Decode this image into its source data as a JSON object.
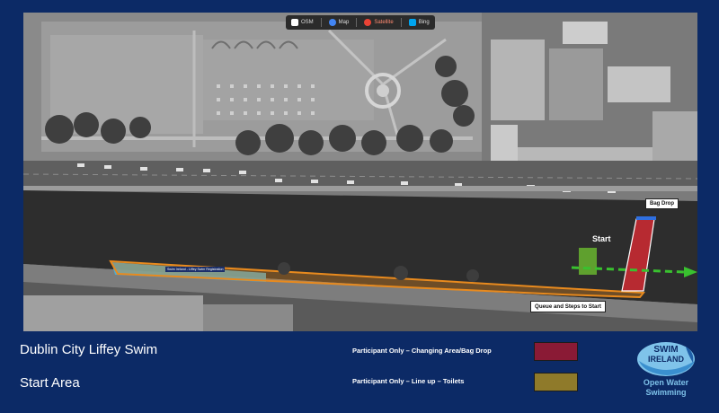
{
  "map_toolbar": {
    "items": [
      {
        "label": "OSM",
        "icon": "osm-icon",
        "color": "#ffffff"
      },
      {
        "label": "Map",
        "icon": "google-icon",
        "color": "#4285f4"
      },
      {
        "label": "Satellite",
        "icon": "google-icon",
        "color": "#ea4335"
      },
      {
        "label": "Bing",
        "icon": "bing-icon",
        "color": "#00a4ef"
      }
    ]
  },
  "map_labels": {
    "bag_drop": "Bag Drop",
    "start": "Start",
    "queue": "Queue and Steps to Start",
    "tiny_sign": "Swim Ireland - Liffey Swim Registration"
  },
  "colors": {
    "changing_area": "#8a1a35",
    "start_area": "#8f7a2a",
    "queue_path": "#e88a1e",
    "queue_fill": "#4fb0d6",
    "start_zone": "#5fa02e",
    "arrow": "#39c12f"
  },
  "bottom": {
    "event_title": "Dublin City Liffey Swim",
    "area_title": "Start Area"
  },
  "legend": [
    {
      "label": "Participant Only – Changing Area/Bag Drop",
      "color": "#8a1a35"
    },
    {
      "label": "Participant Only – Line up – Toilets",
      "color": "#8f7a2a"
    }
  ],
  "logo": {
    "brand_line1": "SWIM",
    "brand_line2": "IRELAND",
    "tagline_line1": "Open Water",
    "tagline_line2": "Swimming"
  }
}
